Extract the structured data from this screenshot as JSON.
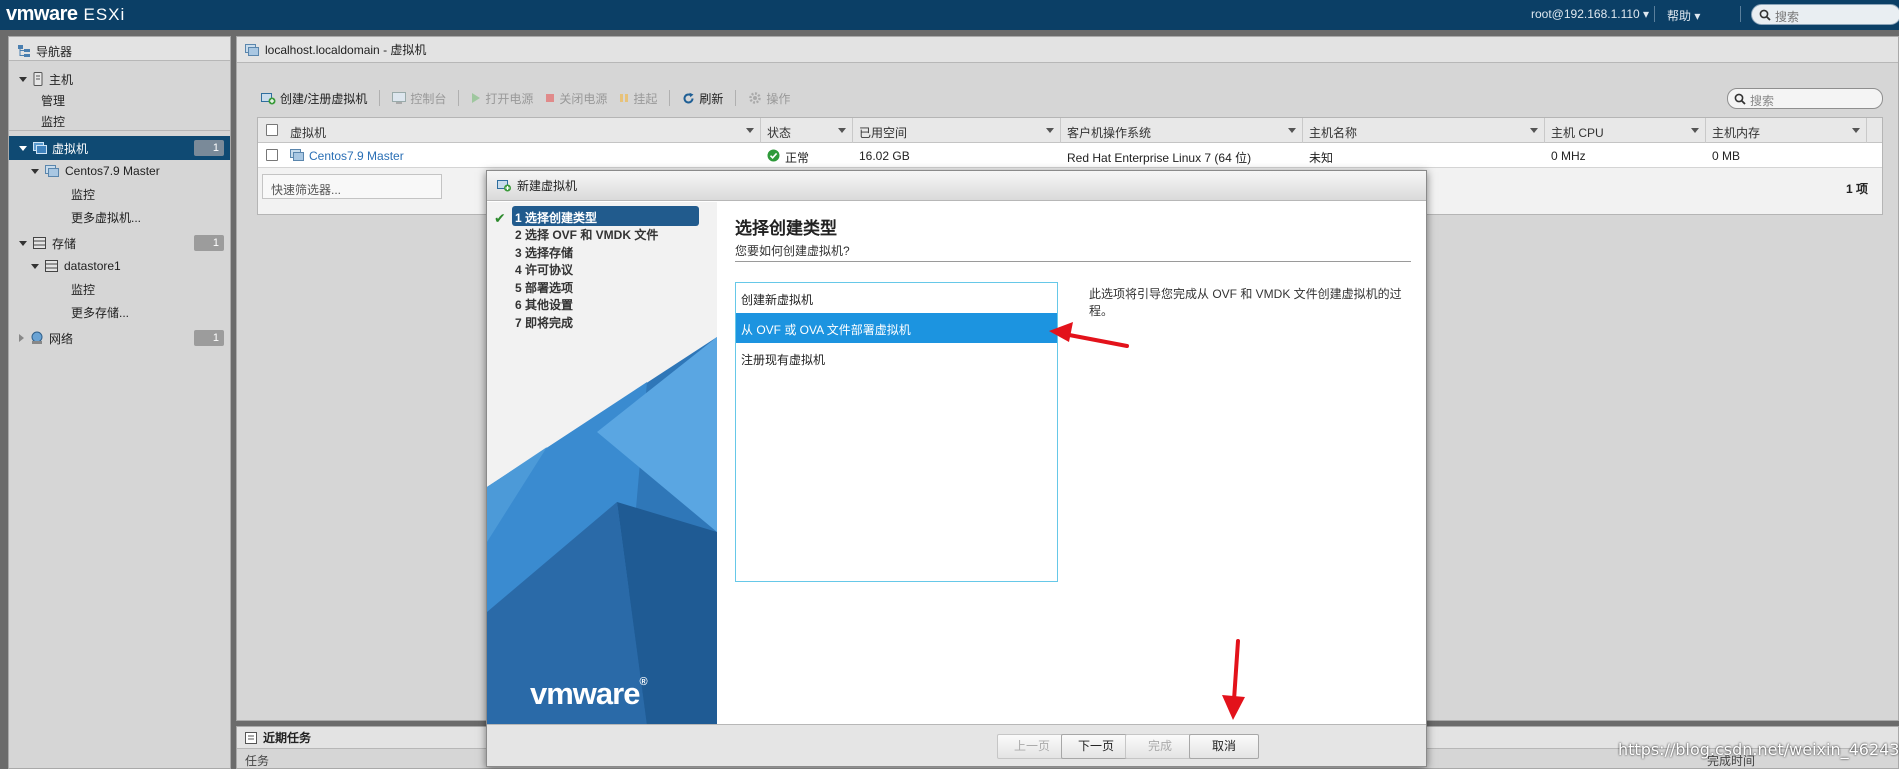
{
  "topbar": {
    "brand": "vmware",
    "product": "ESXi",
    "user": "root@192.168.1.110",
    "help": "帮助",
    "search_placeholder": "搜索"
  },
  "navigator": {
    "title": "导航器",
    "host": "主机",
    "manage": "管理",
    "monitor": "监控",
    "vms": "虚拟机",
    "vms_count": "1",
    "vm_name": "Centos7.9 Master",
    "vm_monitor": "监控",
    "more_vms": "更多虚拟机...",
    "storage": "存储",
    "storage_count": "1",
    "datastore": "datastore1",
    "ds_monitor": "监控",
    "more_storage": "更多存储...",
    "network": "网络",
    "network_count": "1"
  },
  "main": {
    "breadcrumb": "localhost.localdomain - 虚拟机",
    "toolbar": {
      "create": "创建/注册虚拟机",
      "console": "控制台",
      "power_on": "打开电源",
      "power_off": "关闭电源",
      "suspend": "挂起",
      "refresh": "刷新",
      "actions": "操作"
    },
    "search_placeholder": "搜索",
    "columns": [
      "虚拟机",
      "状态",
      "已用空间",
      "客户机操作系统",
      "主机名称",
      "主机 CPU",
      "主机内存"
    ],
    "rows": [
      {
        "name": "Centos7.9 Master",
        "status": "正常",
        "used": "16.02 GB",
        "os": "Red Hat Enterprise Linux 7 (64 位)",
        "hostname": "未知",
        "cpu": "0 MHz",
        "mem": "0 MB"
      }
    ],
    "quick_filter": "快速筛选器...",
    "item_count": "1 项"
  },
  "recent_tasks": {
    "title": "近期任务",
    "col_task": "任务",
    "col_completed": "完成时间"
  },
  "modal": {
    "title": "新建虚拟机",
    "steps": [
      "1 选择创建类型",
      "2 选择 OVF 和 VMDK 文件",
      "3 选择存储",
      "4 许可协议",
      "5 部署选项",
      "6 其他设置",
      "7 即将完成"
    ],
    "brand": "vmware",
    "heading": "选择创建类型",
    "subheading": "您要如何创建虚拟机?",
    "options": [
      "创建新虚拟机",
      "从 OVF 或 OVA 文件部署虚拟机",
      "注册现有虚拟机"
    ],
    "selected_option": 1,
    "description": "此选项将引导您完成从 OVF 和 VMDK 文件创建虚拟机的过程。",
    "buttons": {
      "back": "上一页",
      "next": "下一页",
      "finish": "完成",
      "cancel": "取消"
    }
  },
  "watermark": "https://blog.csdn.net/weixin_46243282",
  "colors": {
    "topbar": "#0b3f66",
    "selected_nav": "#0f4a73",
    "selected_option": "#1c94e0",
    "step_current": "#215b8d",
    "annotation_arrow": "#e3121b"
  }
}
